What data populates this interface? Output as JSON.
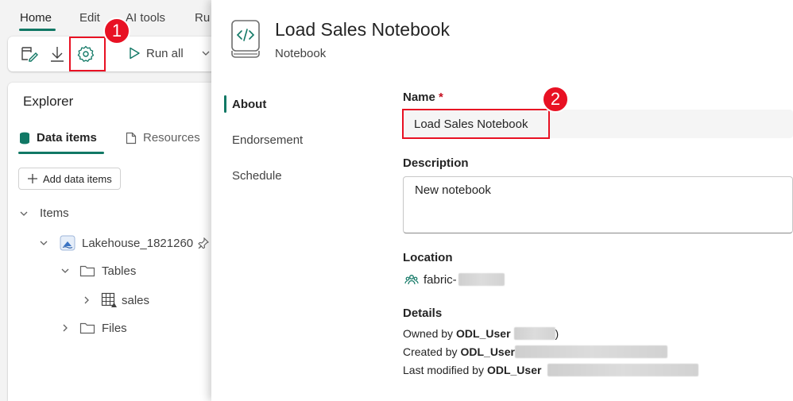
{
  "app": {
    "tabs": [
      {
        "label": "Home"
      },
      {
        "label": "Edit"
      },
      {
        "label": "AI tools"
      },
      {
        "label": "Ru"
      }
    ],
    "toolbar": {
      "run_all_label": "Run all",
      "icons": [
        "notebook-edit-icon",
        "download-icon",
        "settings-gear-icon",
        "play-icon",
        "chevron-down-icon"
      ]
    },
    "callouts": [
      {
        "label": "1"
      },
      {
        "label": "2"
      }
    ],
    "accent_color": "#117865",
    "highlight_color": "#e81123",
    "explorer": {
      "title": "Explorer",
      "tabs": [
        {
          "label": "Data items"
        },
        {
          "label": "Resources"
        }
      ],
      "add_button_label": "Add data items",
      "tree": {
        "root_label": "Items",
        "lakehouse_label": "Lakehouse_1821260",
        "tables_label": "Tables",
        "sales_label": "sales",
        "files_label": "Files"
      }
    }
  },
  "panel": {
    "title": "Load Sales Notebook",
    "subtitle": "Notebook",
    "nav": [
      {
        "label": "About"
      },
      {
        "label": "Endorsement"
      },
      {
        "label": "Schedule"
      }
    ],
    "form": {
      "name_label": "Name",
      "required_marker": "*",
      "name_value": "Load Sales Notebook",
      "description_label": "Description",
      "description_value": "New notebook",
      "location_label": "Location",
      "location_value": "fabric-",
      "details_label": "Details",
      "owned_by_prefix": "Owned by",
      "owned_by_user": "ODL_User",
      "owned_by_suffix": ")",
      "created_by_prefix": "Created by",
      "created_by_user": "ODL_User",
      "modified_by_prefix": "Last modified by",
      "modified_by_user": "ODL_User"
    }
  }
}
